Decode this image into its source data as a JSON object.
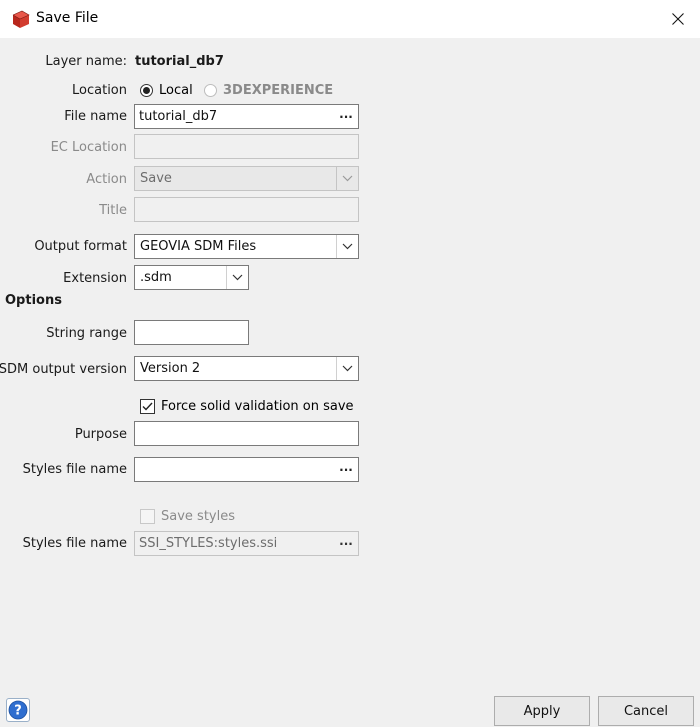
{
  "window": {
    "title": "Save File"
  },
  "form": {
    "layer_name_label": "Layer name:",
    "layer_name_value": "tutorial_db7",
    "location_label": "Location",
    "location_local": "Local",
    "location_3dx": "3DEXPERIENCE",
    "file_name_label": "File name",
    "file_name_value": "tutorial_db7",
    "browse": "...",
    "ec_location_label": "EC Location",
    "action_label": "Action",
    "action_value": "Save",
    "title_label": "Title",
    "output_format_label": "Output format",
    "output_format_value": "GEOVIA SDM Files",
    "extension_label": "Extension",
    "extension_value": ".sdm",
    "options_header": "Options",
    "string_range_label": "String range",
    "sdm_version_label": "SDM output version",
    "sdm_version_value": "Version 2",
    "force_validation_label": "Force solid validation on save",
    "purpose_label": "Purpose",
    "styles_file_label_1": "Styles file name",
    "save_styles_label": "Save styles",
    "styles_file_label_2": "Styles file name",
    "styles_file_value_2": "SSI_STYLES:styles.ssi"
  },
  "buttons": {
    "apply": "Apply",
    "cancel": "Cancel"
  },
  "state": {
    "location_selected": "Local",
    "force_validation_checked": true,
    "save_styles_checked": false
  }
}
